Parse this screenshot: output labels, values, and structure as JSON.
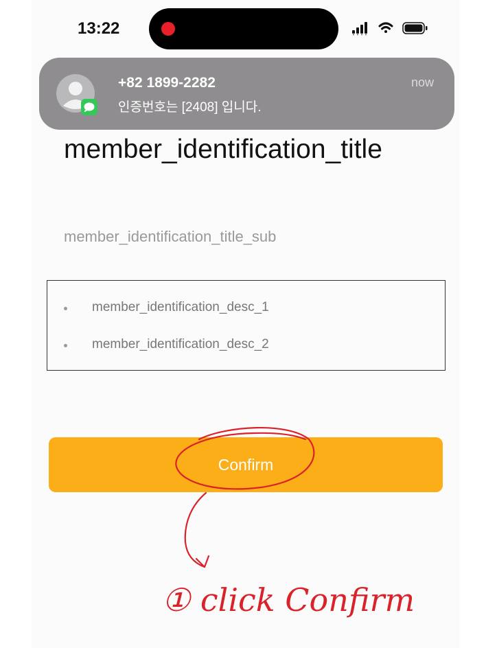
{
  "status_bar": {
    "time": "13:22",
    "icons": [
      "cellular-signal-icon",
      "wifi-icon",
      "battery-icon"
    ],
    "recording_indicator_color": "#e8202a"
  },
  "notification": {
    "sender": "+82 1899-2282",
    "body": "인증번호는 [2408] 입니다.",
    "time": "now",
    "icons": [
      "contact-avatar-icon",
      "messages-app-icon"
    ]
  },
  "page": {
    "title": "member_identification_title",
    "subtitle": "member_identification_title_sub",
    "descriptions": [
      "member_identification_desc_1",
      "member_identification_desc_2"
    ]
  },
  "confirm_button": {
    "label": "Confirm",
    "color": "#fbae17"
  },
  "annotation": {
    "note": "① click Confirm",
    "color": "#d9232a"
  }
}
